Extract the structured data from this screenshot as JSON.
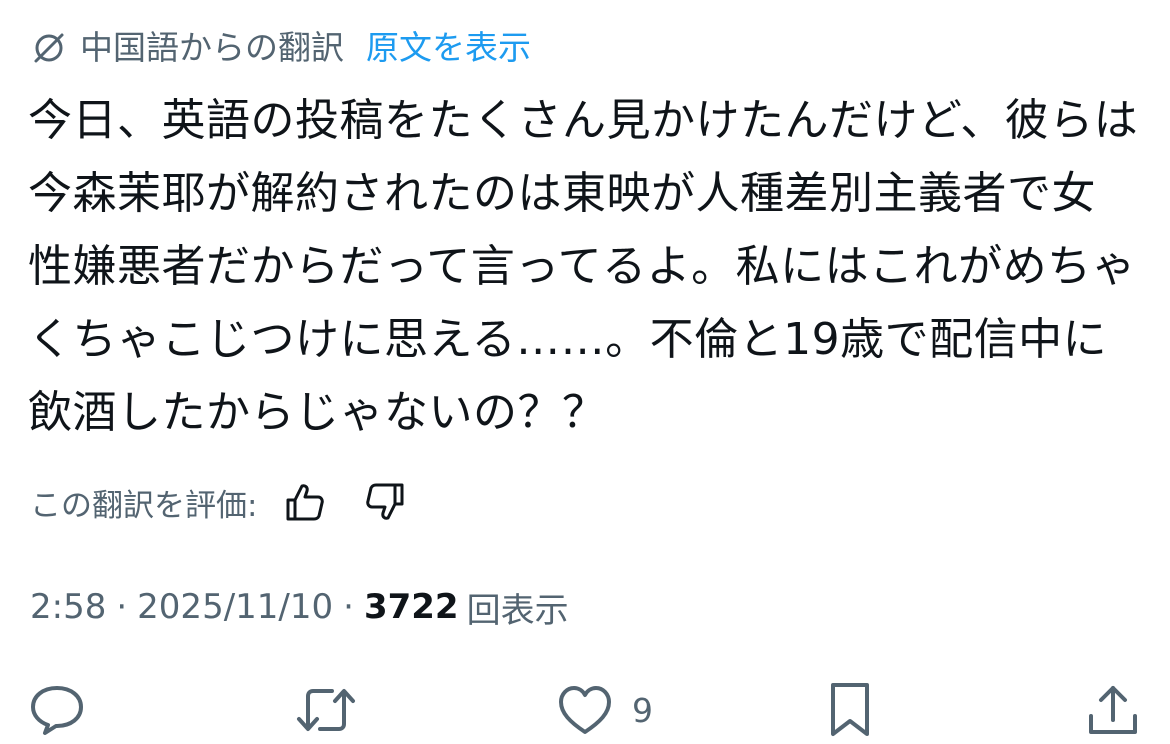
{
  "translation": {
    "from_label": "中国語からの翻訳",
    "show_original_label": "原文を表示"
  },
  "tweet": {
    "text": "今日、英語の投稿をたくさん見かけたんだけど、彼らは今森茉耶が解約されたのは東映が人種差別主義者で女性嫌悪者だからだって言ってるよ。私にはこれがめちゃくちゃこじつけに思える……。不倫と19歳で配信中に飲酒したからじゃないの？？"
  },
  "rating": {
    "label": "この翻訳を評価:"
  },
  "meta": {
    "time": "2:58",
    "separator": "·",
    "date": "2025/11/10",
    "views_count": "3722",
    "views_label": "回表示"
  },
  "actions": {
    "like_count": "9"
  },
  "icons": {
    "translation": "globe-translate-icon",
    "thumbs_up": "thumbs-up-icon",
    "thumbs_down": "thumbs-down-icon",
    "reply": "reply-bubble-icon",
    "retweet": "retweet-icon",
    "like": "heart-icon",
    "bookmark": "bookmark-icon",
    "share": "share-upload-icon"
  },
  "colors": {
    "link": "#1d9bf0",
    "secondary_text": "#536471",
    "primary_text": "#0f1419"
  }
}
